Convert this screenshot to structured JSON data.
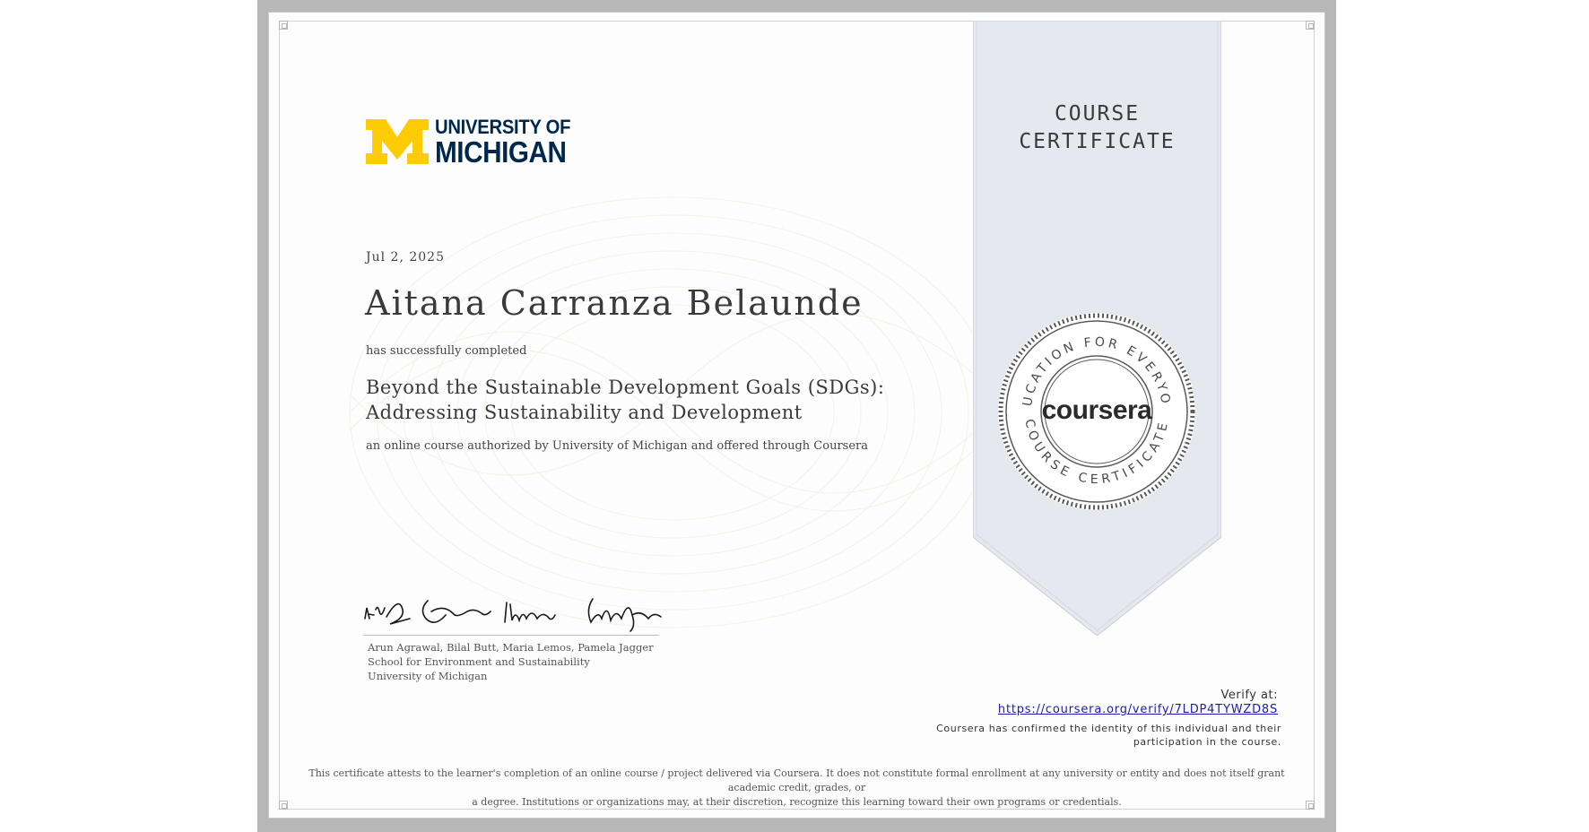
{
  "banner": {
    "title_line1": "COURSE",
    "title_line2": "CERTIFICATE",
    "color": "#e5e8ee"
  },
  "institution": {
    "logo_line1": "UNIVERSITY OF",
    "logo_line2": "MICHIGAN",
    "brand_colors": {
      "maize": "#ffcb05",
      "blue": "#00274c"
    }
  },
  "certificate": {
    "date": "Jul 2, 2025",
    "recipient": "Aitana Carranza Belaunde",
    "completed_text": "has successfully completed",
    "course_line1": "Beyond the Sustainable Development Goals (SDGs):",
    "course_line2": "Addressing Sustainability and Development",
    "description": "an online course authorized by University of Michigan and offered through Coursera"
  },
  "signatories": {
    "names": "Arun Agrawal, Bilal Butt, Maria Lemos, Pamela Jagger",
    "school": "School for Environment and Sustainability",
    "university": "University of Michigan"
  },
  "seal": {
    "top_text": "EDUCATION FOR EVERYONE",
    "center_text": "coursera",
    "bottom_text": "COURSE CERTIFICATE"
  },
  "verification": {
    "label": "Verify at:",
    "url": "https://coursera.org/verify/7LDP4TYWZD8S",
    "note_line1": "Coursera has confirmed the identity of this individual and their",
    "note_line2": "participation in the course."
  },
  "disclaimer": {
    "line1": "This certificate attests to the learner's completion of an online course / project delivered via Coursera. It does not constitute formal enrollment at any university or entity and does not itself grant academic credit, grades, or",
    "line2": "a degree. Institutions or organizations may, at their discretion, recognize this learning toward their own programs or credentials."
  }
}
